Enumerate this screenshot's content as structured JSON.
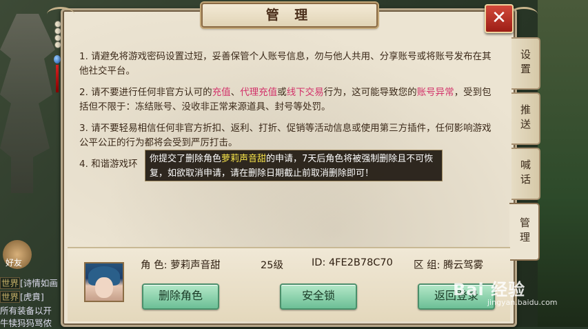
{
  "dialog": {
    "title": "管 理",
    "close_label": "✕"
  },
  "tabs": [
    "设置",
    "推送",
    "喊话",
    "管理"
  ],
  "rules": [
    {
      "index": "1.",
      "text": "请避免将游戏密码设置过短，妥善保管个人账号信息，勿与他人共用、分享账号或将账号发布在其他社交平台。"
    },
    {
      "index": "2.",
      "pre": "请不要进行任何非官方认可的",
      "r1": "充值",
      "s1": "、",
      "r2": "代理充值",
      "s2": "或",
      "r3": "线下交易",
      "s3": "行为，这可能导致您的",
      "r4": "账号异常",
      "post": "，受到包括但不限于：冻结账号、没收非正常来源道具、封号等处罚。"
    },
    {
      "index": "3.",
      "text": "请不要轻易相信任何非官方折扣、返利、打折、促销等活动信息或使用第三方插件，任何影响游戏公平公正的行为都将会受到严厉打击。"
    },
    {
      "index": "4.",
      "text": "和谐游戏环"
    }
  ],
  "tooltip": {
    "pre": "你提交了删除角色",
    "name": "萝莉声音甜",
    "post": "的申请，7天后角色将被强制删除且不可恢复，如欲取消申请，请在删除日期截止前取消删除即可！"
  },
  "character": {
    "role_label": "角 色:",
    "role_name": "萝莉声音甜",
    "level": "25级",
    "id_label": "ID:",
    "id_value": "4FE2B78C70",
    "zone_label": "区 组:",
    "zone_value": "腾云驾雾"
  },
  "buttons": {
    "delete": "删除角色",
    "lock": "安全锁",
    "logout": "返回登录"
  },
  "left_ui": {
    "friend_label": "好友",
    "chat": [
      {
        "channel": "世界",
        "text": "[诗情如画"
      },
      {
        "channel": "世界",
        "text": "[虎賁]"
      },
      {
        "channel": "",
        "text": "所有装备以开"
      },
      {
        "channel": "",
        "text": "牛犊犸犸骂侬"
      }
    ]
  },
  "watermark": {
    "logo": "Bai 经验",
    "url": "jingyan.baidu.com"
  },
  "colors": {
    "highlight_red": "#d2326a",
    "tooltip_name": "#f7e44a",
    "button_green": "#6cbf96"
  }
}
